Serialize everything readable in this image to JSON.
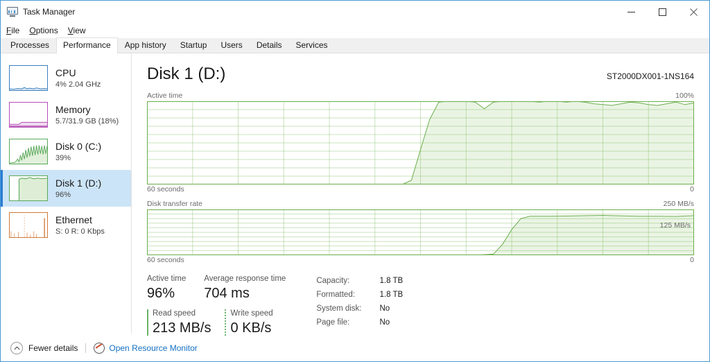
{
  "window": {
    "title": "Task Manager",
    "icon": "task-manager-icon",
    "controls": {
      "minimize": "—",
      "maximize": "□",
      "close": "✕"
    }
  },
  "menu": {
    "items": [
      "File",
      "Options",
      "View"
    ]
  },
  "tabs": {
    "items": [
      "Processes",
      "Performance",
      "App history",
      "Startup",
      "Users",
      "Details",
      "Services"
    ],
    "active": "Performance"
  },
  "sidebar": {
    "items": [
      {
        "name": "CPU",
        "sub": "4%  2.04 GHz",
        "color": "#3b7fbf",
        "selected": false
      },
      {
        "name": "Memory",
        "sub": "5.7/31.9 GB (18%)",
        "color": "#b44fb4",
        "selected": false
      },
      {
        "name": "Disk 0 (C:)",
        "sub": "39%",
        "color": "#5aa85a",
        "selected": false
      },
      {
        "name": "Disk 1 (D:)",
        "sub": "96%",
        "color": "#5aa85a",
        "selected": true
      },
      {
        "name": "Ethernet",
        "sub": "S: 0 R: 0 Kbps",
        "color": "#d07a3a",
        "selected": false
      }
    ]
  },
  "main": {
    "title": "Disk 1 (D:)",
    "model": "ST2000DX001-1NS164",
    "accent": "#6aae4a"
  },
  "chart_data": [
    {
      "type": "area",
      "name": "active-time-graph",
      "title": "Active time",
      "ylabel_max": "100%",
      "ylabel_min": "",
      "xlabel_left": "60 seconds",
      "xlabel_right": "0",
      "ylim": [
        0,
        100
      ],
      "xlim": [
        0,
        60
      ],
      "grid": true,
      "grid_cols": 12,
      "grid_rows": 10,
      "line_color": "#6aae4a",
      "fill_color": "rgba(122,186,90,0.16)",
      "x": [
        0,
        2,
        4,
        6,
        8,
        10,
        12,
        14,
        16,
        18,
        20,
        22,
        24,
        26,
        28,
        29,
        30,
        31,
        32,
        33,
        34,
        35,
        36,
        37,
        38,
        39,
        40,
        41,
        42,
        43,
        44,
        45,
        46,
        47,
        48,
        49,
        50,
        51,
        52,
        53,
        54,
        55,
        56,
        57,
        58,
        59,
        60
      ],
      "values": [
        0,
        0,
        0,
        0,
        0,
        0,
        0,
        0,
        0,
        0,
        0,
        0,
        0,
        0,
        0,
        5,
        42,
        78,
        99,
        100,
        100,
        100,
        99,
        91,
        99,
        100,
        100,
        100,
        100,
        99,
        100,
        100,
        99,
        100,
        99,
        97,
        96,
        95,
        97,
        99,
        98,
        96,
        95,
        97,
        99,
        96,
        98
      ]
    },
    {
      "type": "area",
      "name": "disk-transfer-rate-graph",
      "title": "Disk transfer rate",
      "ylabel_max": "250 MB/s",
      "ylabel_mid": "125 MB/s",
      "ylabel_min": "0",
      "xlabel_left": "60 seconds",
      "xlabel_right": "0",
      "ylim": [
        0,
        250
      ],
      "xlim": [
        0,
        60
      ],
      "grid": true,
      "grid_cols": 12,
      "grid_rows": 10,
      "line_color": "#6aae4a",
      "fill_color": "rgba(122,186,90,0.16)",
      "x": [
        0,
        4,
        8,
        12,
        16,
        20,
        24,
        28,
        32,
        36,
        38,
        39,
        40,
        41,
        42,
        44,
        46,
        48,
        50,
        52,
        54,
        56,
        58,
        60
      ],
      "values": [
        0,
        0,
        0,
        0,
        0,
        0,
        0,
        0,
        0,
        0,
        6,
        60,
        140,
        200,
        213,
        213,
        214,
        216,
        218,
        215,
        213,
        213,
        212,
        216
      ]
    }
  ],
  "stats": {
    "active_time": {
      "caption": "Active time",
      "value": "96%"
    },
    "avg_response": {
      "caption": "Average response time",
      "value": "704 ms"
    },
    "read_speed": {
      "caption": "Read speed",
      "value": "213 MB/s"
    },
    "write_speed": {
      "caption": "Write speed",
      "value": "0 KB/s"
    },
    "info": [
      {
        "key": "Capacity:",
        "value": "1.8 TB"
      },
      {
        "key": "Formatted:",
        "value": "1.8 TB"
      },
      {
        "key": "System disk:",
        "value": "No"
      },
      {
        "key": "Page file:",
        "value": "No"
      }
    ]
  },
  "footer": {
    "fewer_details": "Fewer details",
    "resource_monitor": "Open Resource Monitor"
  }
}
